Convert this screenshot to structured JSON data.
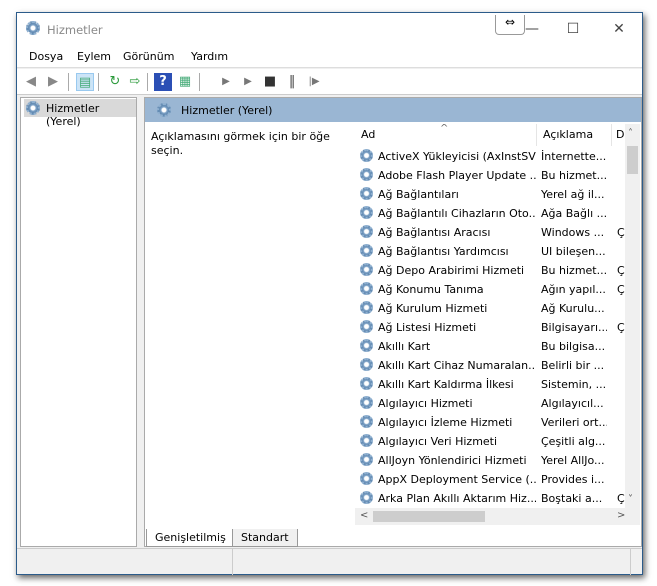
{
  "window": {
    "title": "Hizmetler",
    "controls": {
      "minimize": "—",
      "maximize": "☐",
      "close": "✕"
    },
    "resize_cursor": "⇔"
  },
  "menu": [
    "Dosya",
    "Eylem",
    "Görünüm",
    "Yardım"
  ],
  "toolbar": [
    "back-icon",
    "forward-icon",
    "show-hide-tree-icon",
    "refresh-icon",
    "export-list-icon",
    "help-icon",
    "properties-icon",
    "start-icon",
    "start-paused-icon",
    "stop-icon",
    "pause-icon",
    "restart-icon"
  ],
  "tree": {
    "selected": "Hizmetler (Yerel)"
  },
  "panel": {
    "title": "Hizmetler (Yerel)",
    "description": "Açıklamasını görmek için bir öğe seçin."
  },
  "list": {
    "columns": [
      "Ad",
      "Açıklama",
      "D"
    ],
    "rows": [
      {
        "name": "ActiveX Yükleyicisi (AxInstSV)",
        "desc": "İnternette...",
        "state": ""
      },
      {
        "name": "Adobe Flash Player Update ...",
        "desc": "Bu hizmet...",
        "state": ""
      },
      {
        "name": "Ağ Bağlantıları",
        "desc": "Yerel ağ il...",
        "state": ""
      },
      {
        "name": "Ağ Bağlantılı Cihazların Oto...",
        "desc": "Ağa Bağlı ...",
        "state": ""
      },
      {
        "name": "Ağ Bağlantısı Aracısı",
        "desc": "Windows ...",
        "state": "Ç"
      },
      {
        "name": "Ağ Bağlantısı Yardımcısı",
        "desc": "UI bileşen...",
        "state": ""
      },
      {
        "name": "Ağ Depo Arabirimi Hizmeti",
        "desc": "Bu hizmet...",
        "state": "Ç"
      },
      {
        "name": "Ağ Konumu Tanıma",
        "desc": "Ağın yapıl...",
        "state": "Ç"
      },
      {
        "name": "Ağ Kurulum Hizmeti",
        "desc": "Ağ Kurulu...",
        "state": ""
      },
      {
        "name": "Ağ Listesi Hizmeti",
        "desc": "Bilgisayarı...",
        "state": "Ç"
      },
      {
        "name": "Akıllı Kart",
        "desc": "Bu bilgisa...",
        "state": ""
      },
      {
        "name": "Akıllı Kart Cihaz Numaralan...",
        "desc": "Belirli bir ...",
        "state": ""
      },
      {
        "name": "Akıllı Kart Kaldırma İlkesi",
        "desc": "Sistemin, ...",
        "state": ""
      },
      {
        "name": "Algılayıcı Hizmeti",
        "desc": "Algılayıcıl...",
        "state": ""
      },
      {
        "name": "Algılayıcı İzleme Hizmeti",
        "desc": "Verileri ort...",
        "state": ""
      },
      {
        "name": "Algılayıcı Veri Hizmeti",
        "desc": "Çeşitli alg...",
        "state": ""
      },
      {
        "name": "AllJoyn Yönlendirici Hizmeti",
        "desc": "Yerel AllJo...",
        "state": ""
      },
      {
        "name": "AppX Deployment Service (...",
        "desc": "Provides i...",
        "state": ""
      },
      {
        "name": "Arka Plan Akıllı Aktarım Hiz...",
        "desc": "Boştaki a...",
        "state": "Ç"
      }
    ]
  },
  "tabs": [
    "Genişletilmiş",
    "Standart"
  ]
}
